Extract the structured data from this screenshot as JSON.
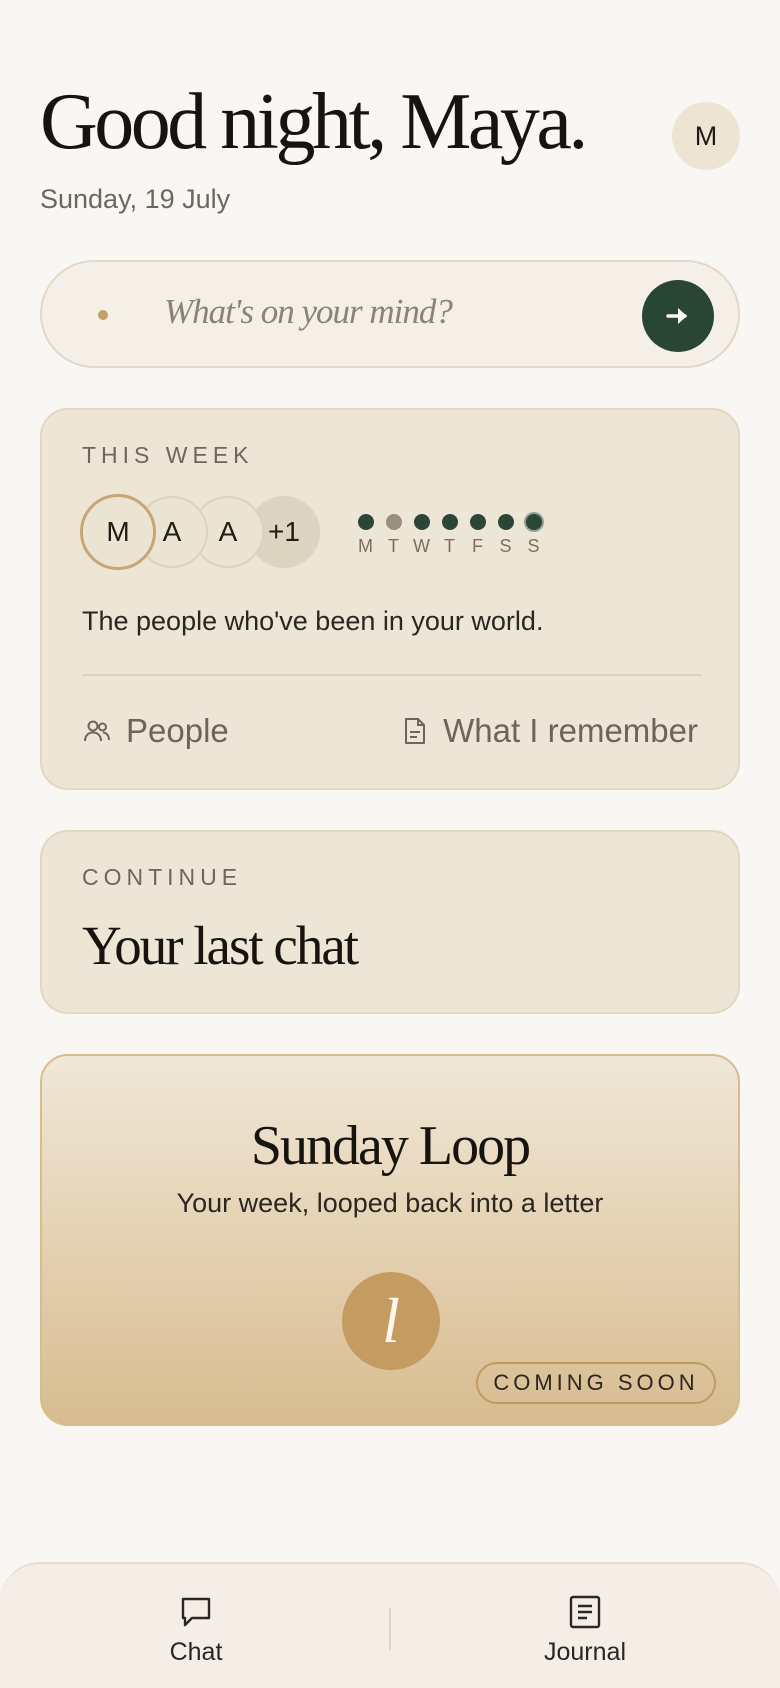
{
  "header": {
    "greeting": "Good night, Maya.",
    "date": "Sunday, 19 July",
    "avatar_initial": "M"
  },
  "prompt": {
    "placeholder": "What's on your mind?",
    "send_icon": "arrow-right-icon"
  },
  "this_week": {
    "overline": "THIS WEEK",
    "avatars": [
      "M",
      "A",
      "A",
      "+1"
    ],
    "days": [
      {
        "letter": "M",
        "active": true
      },
      {
        "letter": "T",
        "active": false
      },
      {
        "letter": "W",
        "active": true
      },
      {
        "letter": "T",
        "active": true
      },
      {
        "letter": "F",
        "active": true
      },
      {
        "letter": "S",
        "active": true
      },
      {
        "letter": "S",
        "active": true
      }
    ],
    "description": "The people who've been in your world.",
    "people_label": "People",
    "remember_label": "What I remember"
  },
  "continue": {
    "overline": "CONTINUE",
    "title": "Your last chat"
  },
  "sunday_loop": {
    "title": "Sunday Loop",
    "subtitle": "Your week, looped back into a letter",
    "mark": "l",
    "badge": "COMING SOON"
  },
  "tabbar": {
    "chat_label": "Chat",
    "journal_label": "Journal"
  },
  "colors": {
    "background": "#f9f7f3",
    "accent_green": "#284536",
    "gold": "#c49c62"
  }
}
